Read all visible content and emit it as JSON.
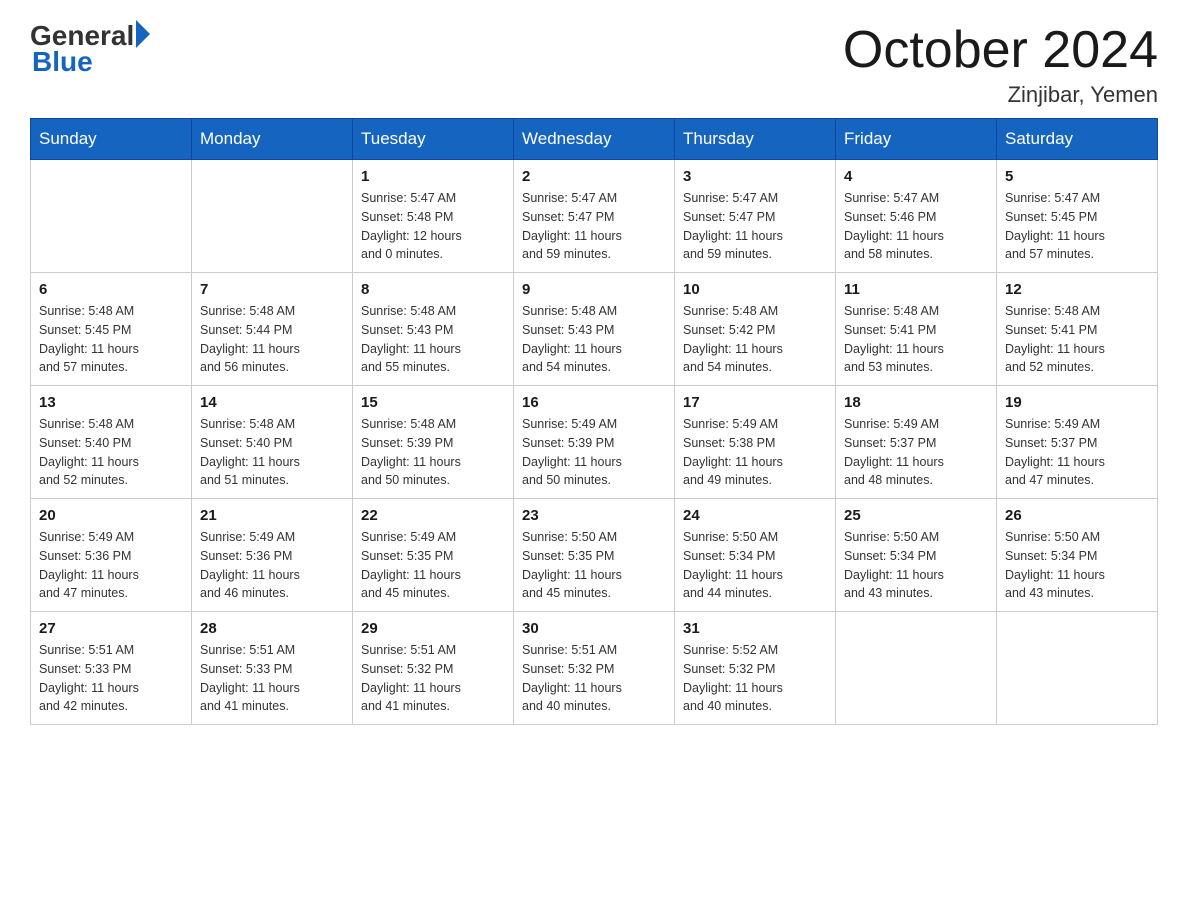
{
  "header": {
    "logo": {
      "general": "General",
      "blue": "Blue"
    },
    "title": "October 2024",
    "location": "Zinjibar, Yemen"
  },
  "weekdays": [
    "Sunday",
    "Monday",
    "Tuesday",
    "Wednesday",
    "Thursday",
    "Friday",
    "Saturday"
  ],
  "weeks": [
    [
      {
        "day": "",
        "info": ""
      },
      {
        "day": "",
        "info": ""
      },
      {
        "day": "1",
        "info": "Sunrise: 5:47 AM\nSunset: 5:48 PM\nDaylight: 12 hours\nand 0 minutes."
      },
      {
        "day": "2",
        "info": "Sunrise: 5:47 AM\nSunset: 5:47 PM\nDaylight: 11 hours\nand 59 minutes."
      },
      {
        "day": "3",
        "info": "Sunrise: 5:47 AM\nSunset: 5:47 PM\nDaylight: 11 hours\nand 59 minutes."
      },
      {
        "day": "4",
        "info": "Sunrise: 5:47 AM\nSunset: 5:46 PM\nDaylight: 11 hours\nand 58 minutes."
      },
      {
        "day": "5",
        "info": "Sunrise: 5:47 AM\nSunset: 5:45 PM\nDaylight: 11 hours\nand 57 minutes."
      }
    ],
    [
      {
        "day": "6",
        "info": "Sunrise: 5:48 AM\nSunset: 5:45 PM\nDaylight: 11 hours\nand 57 minutes."
      },
      {
        "day": "7",
        "info": "Sunrise: 5:48 AM\nSunset: 5:44 PM\nDaylight: 11 hours\nand 56 minutes."
      },
      {
        "day": "8",
        "info": "Sunrise: 5:48 AM\nSunset: 5:43 PM\nDaylight: 11 hours\nand 55 minutes."
      },
      {
        "day": "9",
        "info": "Sunrise: 5:48 AM\nSunset: 5:43 PM\nDaylight: 11 hours\nand 54 minutes."
      },
      {
        "day": "10",
        "info": "Sunrise: 5:48 AM\nSunset: 5:42 PM\nDaylight: 11 hours\nand 54 minutes."
      },
      {
        "day": "11",
        "info": "Sunrise: 5:48 AM\nSunset: 5:41 PM\nDaylight: 11 hours\nand 53 minutes."
      },
      {
        "day": "12",
        "info": "Sunrise: 5:48 AM\nSunset: 5:41 PM\nDaylight: 11 hours\nand 52 minutes."
      }
    ],
    [
      {
        "day": "13",
        "info": "Sunrise: 5:48 AM\nSunset: 5:40 PM\nDaylight: 11 hours\nand 52 minutes."
      },
      {
        "day": "14",
        "info": "Sunrise: 5:48 AM\nSunset: 5:40 PM\nDaylight: 11 hours\nand 51 minutes."
      },
      {
        "day": "15",
        "info": "Sunrise: 5:48 AM\nSunset: 5:39 PM\nDaylight: 11 hours\nand 50 minutes."
      },
      {
        "day": "16",
        "info": "Sunrise: 5:49 AM\nSunset: 5:39 PM\nDaylight: 11 hours\nand 50 minutes."
      },
      {
        "day": "17",
        "info": "Sunrise: 5:49 AM\nSunset: 5:38 PM\nDaylight: 11 hours\nand 49 minutes."
      },
      {
        "day": "18",
        "info": "Sunrise: 5:49 AM\nSunset: 5:37 PM\nDaylight: 11 hours\nand 48 minutes."
      },
      {
        "day": "19",
        "info": "Sunrise: 5:49 AM\nSunset: 5:37 PM\nDaylight: 11 hours\nand 47 minutes."
      }
    ],
    [
      {
        "day": "20",
        "info": "Sunrise: 5:49 AM\nSunset: 5:36 PM\nDaylight: 11 hours\nand 47 minutes."
      },
      {
        "day": "21",
        "info": "Sunrise: 5:49 AM\nSunset: 5:36 PM\nDaylight: 11 hours\nand 46 minutes."
      },
      {
        "day": "22",
        "info": "Sunrise: 5:49 AM\nSunset: 5:35 PM\nDaylight: 11 hours\nand 45 minutes."
      },
      {
        "day": "23",
        "info": "Sunrise: 5:50 AM\nSunset: 5:35 PM\nDaylight: 11 hours\nand 45 minutes."
      },
      {
        "day": "24",
        "info": "Sunrise: 5:50 AM\nSunset: 5:34 PM\nDaylight: 11 hours\nand 44 minutes."
      },
      {
        "day": "25",
        "info": "Sunrise: 5:50 AM\nSunset: 5:34 PM\nDaylight: 11 hours\nand 43 minutes."
      },
      {
        "day": "26",
        "info": "Sunrise: 5:50 AM\nSunset: 5:34 PM\nDaylight: 11 hours\nand 43 minutes."
      }
    ],
    [
      {
        "day": "27",
        "info": "Sunrise: 5:51 AM\nSunset: 5:33 PM\nDaylight: 11 hours\nand 42 minutes."
      },
      {
        "day": "28",
        "info": "Sunrise: 5:51 AM\nSunset: 5:33 PM\nDaylight: 11 hours\nand 41 minutes."
      },
      {
        "day": "29",
        "info": "Sunrise: 5:51 AM\nSunset: 5:32 PM\nDaylight: 11 hours\nand 41 minutes."
      },
      {
        "day": "30",
        "info": "Sunrise: 5:51 AM\nSunset: 5:32 PM\nDaylight: 11 hours\nand 40 minutes."
      },
      {
        "day": "31",
        "info": "Sunrise: 5:52 AM\nSunset: 5:32 PM\nDaylight: 11 hours\nand 40 minutes."
      },
      {
        "day": "",
        "info": ""
      },
      {
        "day": "",
        "info": ""
      }
    ]
  ]
}
